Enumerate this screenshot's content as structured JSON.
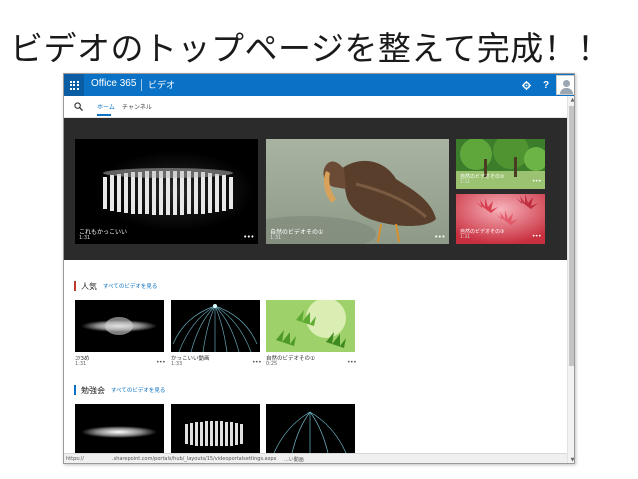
{
  "slide": {
    "title": "ビデオのトップページを整えて完成！！"
  },
  "suitebar": {
    "brand": "Office 365",
    "app_name": "ビデオ",
    "settings_label": "⚙",
    "help_label": "?"
  },
  "nav": {
    "tabs": [
      {
        "label": "ホーム"
      },
      {
        "label": "チャンネル"
      }
    ]
  },
  "spotlight": {
    "tiles": [
      {
        "title": "これもかっこいい",
        "duration": "1:31",
        "more": "•••"
      },
      {
        "title": "自然のビデオその①",
        "duration": "1:31",
        "more": "•••"
      },
      {
        "title": "自然のビデオその②",
        "duration": "1:31",
        "more": "•••"
      },
      {
        "title": "自然のビデオその③",
        "duration": "1:31",
        "more": "•••"
      }
    ]
  },
  "sections": [
    {
      "title": "人気",
      "link": "すべてのビデオを見る",
      "accent": "#c0392b",
      "videos": [
        {
          "title": "ｺﾂ3め",
          "duration": "1:31",
          "more": "•••"
        },
        {
          "title": "かっこいい動画",
          "duration": "1:33",
          "more": "•••"
        },
        {
          "title": "自然のビデオその①",
          "duration": "0:25",
          "more": "•••"
        }
      ]
    },
    {
      "title": "勉強会",
      "link": "すべてのビデオを見る",
      "accent": "#0a72c6",
      "videos": [
        {
          "title": "",
          "duration": "",
          "more": ""
        },
        {
          "title": "",
          "duration": "",
          "more": ""
        },
        {
          "title": "",
          "duration": "",
          "more": ""
        }
      ]
    }
  ],
  "statusbar": {
    "left": "https://",
    "url": ".sharepoint.com/portals/hub/_layouts/15/videoportalsettings.aspx",
    "right": "...い動画"
  },
  "colors": {
    "suitebar": "#0a72c6",
    "accent_link": "#0a72c6",
    "spotlight_bg": "#2b2b2b"
  }
}
